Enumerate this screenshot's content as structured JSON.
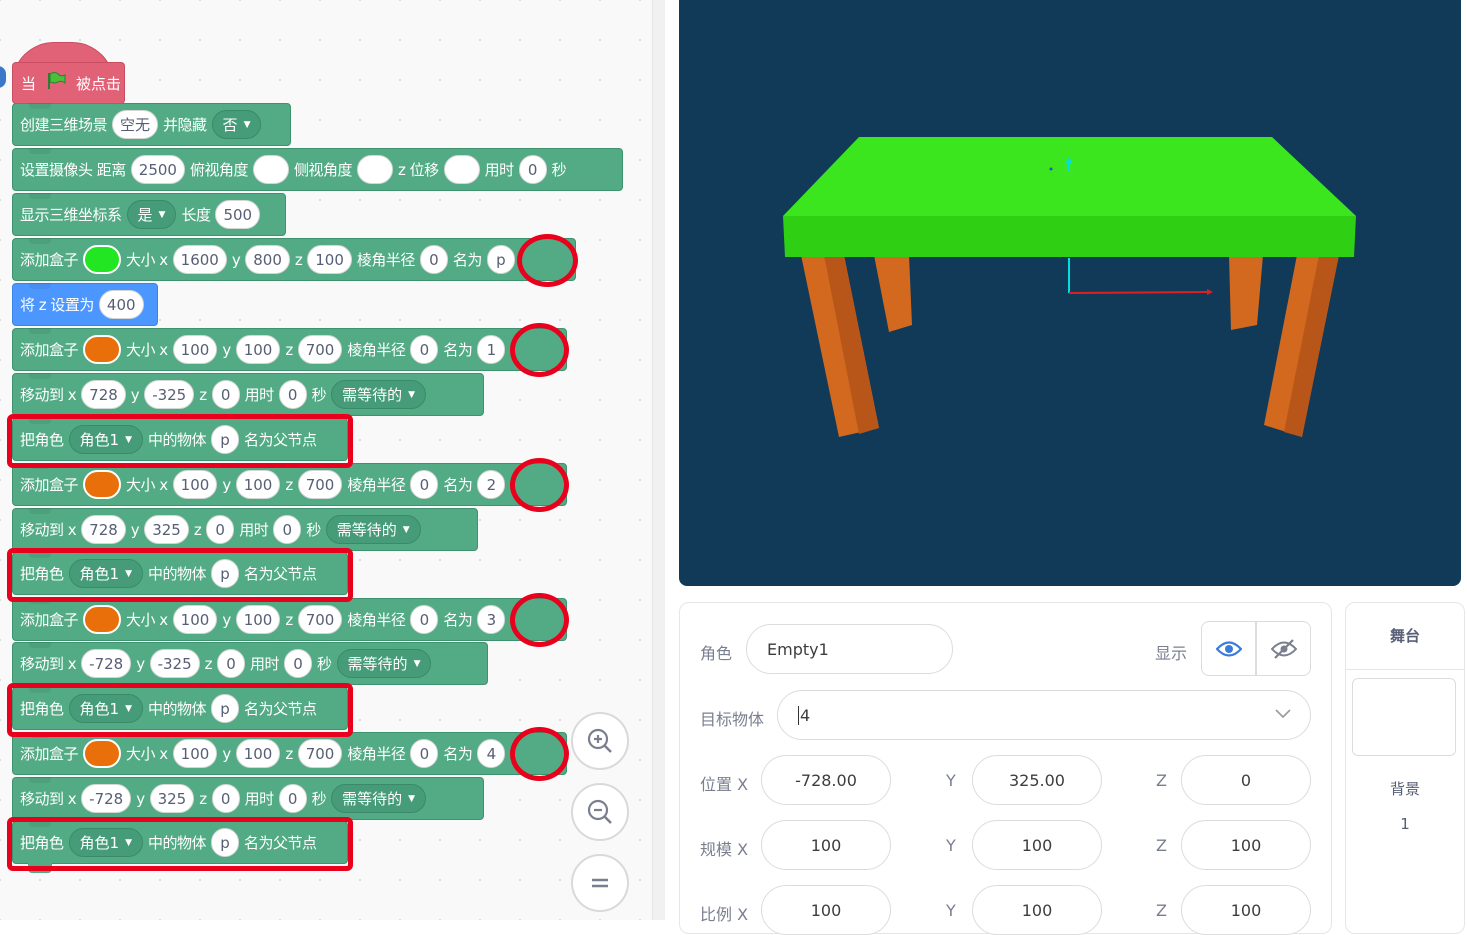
{
  "hat": {
    "prefix": "当",
    "suffix": "被点击",
    "flag_icon": "green-flag-icon"
  },
  "blocks": {
    "create_scene": {
      "label": "创建三维场景",
      "scene": "空无",
      "hide_label": "并隐藏",
      "hide": "否"
    },
    "camera": {
      "label": "设置摄像头 距离",
      "distance": "2500",
      "pitch_label": "俯视角度",
      "pitch": "",
      "yaw_label": "侧视角度",
      "yaw": "",
      "z_label": "z 位移",
      "z": "",
      "time_label": "用时",
      "time": "0",
      "sec": "秒"
    },
    "axes": {
      "label": "显示三维坐标系",
      "show": "是",
      "len_label": "长度",
      "length": "500"
    },
    "box_p": {
      "label": "添加盒子",
      "color": "#22e622",
      "size_label": "大小 x",
      "x": "1600",
      "y_label": "y",
      "y": "800",
      "z_label": "z",
      "z": "100",
      "radius_label": "棱角半径",
      "radius": "0",
      "name_label": "名为",
      "name": "p"
    },
    "set_z": {
      "label": "将 z 设置为",
      "value": "400"
    },
    "box_1": {
      "label": "添加盒子",
      "color": "#e86f0a",
      "size_label": "大小 x",
      "x": "100",
      "y_label": "y",
      "y": "100",
      "z_label": "z",
      "z": "700",
      "radius_label": "棱角半径",
      "radius": "0",
      "name_label": "名为",
      "name": "1"
    },
    "move_1": {
      "label": "移动到 x",
      "x": "728",
      "y_label": "y",
      "y": "-325",
      "z_label": "z",
      "z": "0",
      "time_label": "用时",
      "time": "0",
      "sec": "秒",
      "wait": "需等待的"
    },
    "parent_1": {
      "label": "把角色",
      "role": "角色1",
      "mid": "中的物体",
      "obj": "p",
      "end": "名为父节点"
    },
    "box_2": {
      "label": "添加盒子",
      "color": "#e86f0a",
      "size_label": "大小 x",
      "x": "100",
      "y_label": "y",
      "y": "100",
      "z_label": "z",
      "z": "700",
      "radius_label": "棱角半径",
      "radius": "0",
      "name_label": "名为",
      "name": "2"
    },
    "move_2": {
      "label": "移动到 x",
      "x": "728",
      "y_label": "y",
      "y": "325",
      "z_label": "z",
      "z": "0",
      "time_label": "用时",
      "time": "0",
      "sec": "秒",
      "wait": "需等待的"
    },
    "parent_2": {
      "label": "把角色",
      "role": "角色1",
      "mid": "中的物体",
      "obj": "p",
      "end": "名为父节点"
    },
    "box_3": {
      "label": "添加盒子",
      "color": "#e86f0a",
      "size_label": "大小 x",
      "x": "100",
      "y_label": "y",
      "y": "100",
      "z_label": "z",
      "z": "700",
      "radius_label": "棱角半径",
      "radius": "0",
      "name_label": "名为",
      "name": "3"
    },
    "move_3": {
      "label": "移动到 x",
      "x": "-728",
      "y_label": "y",
      "y": "-325",
      "z_label": "z",
      "z": "0",
      "time_label": "用时",
      "time": "0",
      "sec": "秒",
      "wait": "需等待的"
    },
    "parent_3": {
      "label": "把角色",
      "role": "角色1",
      "mid": "中的物体",
      "obj": "p",
      "end": "名为父节点"
    },
    "box_4": {
      "label": "添加盒子",
      "color": "#e86f0a",
      "size_label": "大小 x",
      "x": "100",
      "y_label": "y",
      "y": "100",
      "z_label": "z",
      "z": "700",
      "radius_label": "棱角半径",
      "radius": "0",
      "name_label": "名为",
      "name": "4"
    },
    "move_4": {
      "label": "移动到 x",
      "x": "-728",
      "y_label": "y",
      "y": "325",
      "z_label": "z",
      "z": "0",
      "time_label": "用时",
      "time": "0",
      "sec": "秒",
      "wait": "需等待的"
    },
    "parent_4": {
      "label": "把角色",
      "role": "角色1",
      "mid": "中的物体",
      "obj": "p",
      "end": "名为父节点"
    }
  },
  "zoom": {
    "in_icon": "zoom-in-icon",
    "out_icon": "zoom-out-icon",
    "reset_icon": "zoom-reset-icon"
  },
  "stage": {
    "background": "#113a59",
    "table_top_color": "#3be61e",
    "leg_color": "#d2691e"
  },
  "props": {
    "role_label": "角色",
    "role": "Empty1",
    "show_label": "显示",
    "target_label": "目标物体",
    "target": "4",
    "pos_label": "位置 X",
    "pos_x": "-728.00",
    "pos_y_label": "Y",
    "pos_y": "325.00",
    "pos_z_label": "Z",
    "pos_z": "0",
    "size_label": "规模 X",
    "size_x": "100",
    "size_y_label": "Y",
    "size_y": "100",
    "size_z_label": "Z",
    "size_z": "100",
    "scale_label": "比例 X",
    "scale_x": "100",
    "scale_y_label": "Y",
    "scale_y": "100",
    "scale_z_label": "Z",
    "scale_z": "100"
  },
  "stage_panel": {
    "title": "舞台",
    "bg_label": "背景",
    "bg_count": "1"
  }
}
